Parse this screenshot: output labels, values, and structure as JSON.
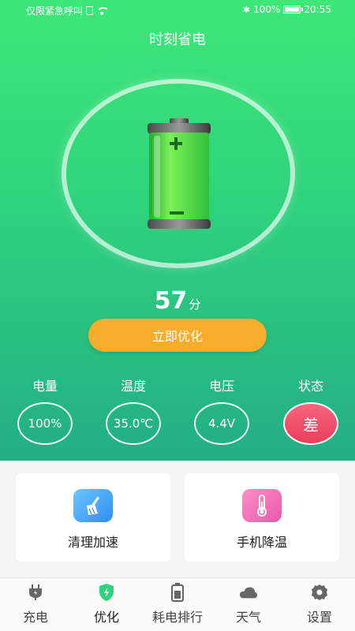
{
  "statusbar": {
    "carrier": "仅限紧急呼叫",
    "battery_percent": "100%",
    "time": "20:55"
  },
  "app": {
    "title": "时刻省电"
  },
  "score": {
    "value": "57",
    "unit": "分"
  },
  "optimize_button": {
    "label": "立即优化"
  },
  "stats": [
    {
      "label": "电量",
      "value": "100%"
    },
    {
      "label": "温度",
      "value": "35.0℃"
    },
    {
      "label": "电压",
      "value": "4.4V"
    },
    {
      "label": "状态",
      "value": "差"
    }
  ],
  "tools": [
    {
      "label": "清理加速",
      "icon": "broom-icon"
    },
    {
      "label": "手机降温",
      "icon": "thermometer-icon"
    }
  ],
  "tabs": [
    {
      "label": "充电",
      "icon": "plug-icon"
    },
    {
      "label": "优化",
      "icon": "shield-icon",
      "active": true
    },
    {
      "label": "耗电排行",
      "icon": "battery-icon"
    },
    {
      "label": "天气",
      "icon": "cloud-icon"
    },
    {
      "label": "设置",
      "icon": "gear-icon"
    }
  ],
  "colors": {
    "primary_green": "#2fd27d",
    "button_orange": "#f6ad2b",
    "bad_status": "#ec4764"
  }
}
